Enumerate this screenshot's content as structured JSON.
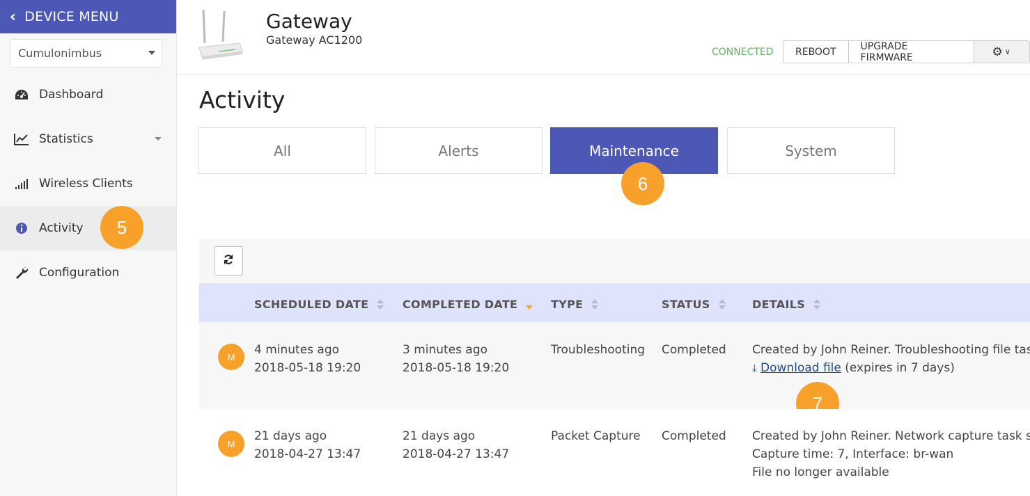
{
  "sidebar": {
    "menu_header": "DEVICE MENU",
    "device_select": "Cumulonimbus",
    "items": [
      {
        "label": "Dashboard",
        "icon": "dashboard-icon"
      },
      {
        "label": "Statistics",
        "icon": "chart-line-icon"
      },
      {
        "label": "Wireless Clients",
        "icon": "signal-bars-icon"
      },
      {
        "label": "Activity",
        "icon": "info-icon",
        "active": true
      },
      {
        "label": "Configuration",
        "icon": "wrench-icon"
      }
    ]
  },
  "header": {
    "title": "Gateway",
    "subtitle": "Gateway AC1200",
    "status": "CONNECTED",
    "reboot": "REBOOT",
    "upgrade": "UPGRADE FIRMWARE"
  },
  "page_title": "Activity",
  "tabs": [
    {
      "label": "All"
    },
    {
      "label": "Alerts"
    },
    {
      "label": "Maintenance",
      "active": true
    },
    {
      "label": "System"
    }
  ],
  "badges": {
    "b5": "5",
    "b6": "6",
    "b7": "7"
  },
  "table": {
    "columns": [
      "SCHEDULED DATE",
      "COMPLETED DATE",
      "TYPE",
      "STATUS",
      "DETAILS"
    ],
    "rows": [
      {
        "avatar": "M",
        "scheduled_rel": "4 minutes ago",
        "scheduled": "2018-05-18 19:20",
        "completed_rel": "3 minutes ago",
        "completed": "2018-05-18 19:20",
        "type": "Troubleshooting",
        "status": "Completed",
        "details_1": "Created by John Reiner. Troubleshooting file task s",
        "download": "Download file",
        "expires": "(expires in 7 days)"
      },
      {
        "avatar": "M",
        "scheduled_rel": "21 days ago",
        "scheduled": "2018-04-27 13:47",
        "completed_rel": "21 days ago",
        "completed": "2018-04-27 13:47",
        "type": "Packet Capture",
        "status": "Completed",
        "details_1": "Created by John Reiner. Network capture task suc",
        "details_2": "Capture time: 7, Interface: br-wan",
        "details_3": "File no longer available"
      }
    ]
  },
  "colors": {
    "accent": "#4d57b5",
    "badge": "#f7a12a",
    "connected": "#5cb85c",
    "table_header": "#dfe3fb"
  }
}
